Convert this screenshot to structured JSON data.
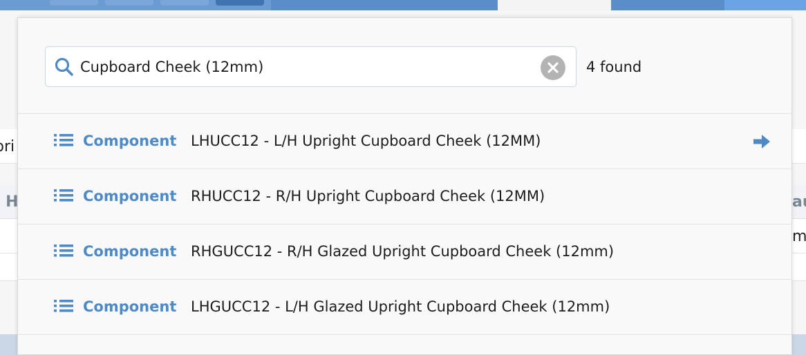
{
  "background": {
    "row_a_text": "pri",
    "row_b_left": "t H",
    "row_b_right": "au",
    "row_c_right": "m"
  },
  "search": {
    "value": "Cupboard Cheek (12mm)",
    "found_label": "4 found"
  },
  "results": [
    {
      "type": "Component",
      "title": "LHUCC12 - L/H Upright Cupboard Cheek (12MM)",
      "selected": true
    },
    {
      "type": "Component",
      "title": "RHUCC12 - R/H Upright Cupboard Cheek (12MM)",
      "selected": false
    },
    {
      "type": "Component",
      "title": "RHGUCC12 - R/H Glazed Upright Cupboard Cheek (12mm)",
      "selected": false
    },
    {
      "type": "Component",
      "title": "LHGUCC12 - L/H Glazed Upright Cupboard Cheek (12mm)",
      "selected": false
    }
  ],
  "colors": {
    "accent": "#4f8ac4",
    "topbar": "#5b8fc9",
    "clear_button": "#b3b3b3"
  },
  "icons": {
    "search": "search-icon",
    "clear": "close-icon",
    "list": "list-icon",
    "arrow": "arrow-right-icon"
  }
}
